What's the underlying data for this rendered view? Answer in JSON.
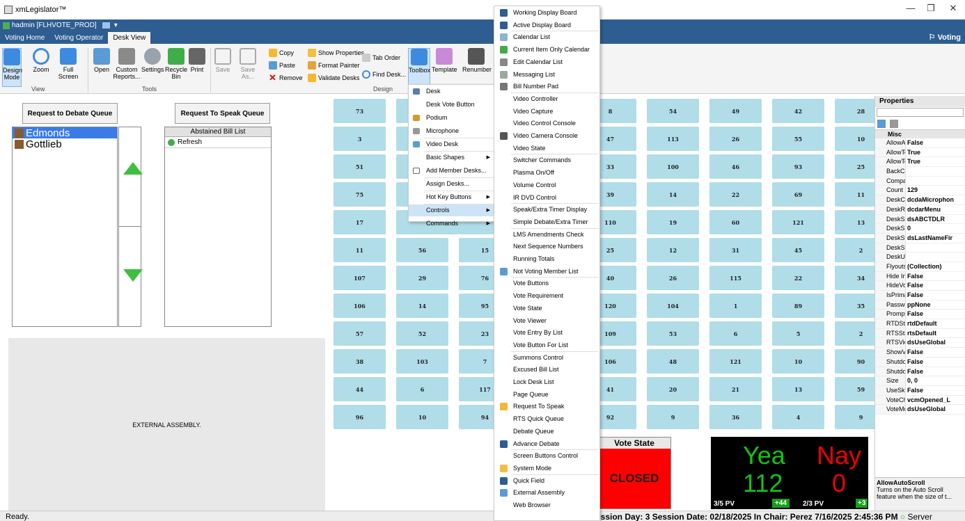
{
  "window": {
    "title": "xmLegislator™",
    "min": "—",
    "max": "❐",
    "close": "✕"
  },
  "user": {
    "label": "hadmin [FLHVOTE_PROD]"
  },
  "ribbon_tabs": [
    "Voting Home",
    "Voting Operator",
    "Desk View"
  ],
  "right_title": "Voting",
  "ribbon": {
    "design_mode": "Design Mode",
    "zoom": "Zoom",
    "full_screen": "Full Screen",
    "open": "Open",
    "custom_reports": "Custom Reports...",
    "settings": "Settings",
    "recycle_bin": "Recycle Bin",
    "print": "Print",
    "save": "Save",
    "save_as": "Save As...",
    "copy": "Copy",
    "paste": "Paste",
    "remove": "Remove",
    "show_properties": "Show Properties",
    "format_painter": "Format Painter",
    "validate_desks": "Validate Desks",
    "tab_order": "Tab Order",
    "find_desk": "Find Desk...",
    "toolbox": "Toolbox",
    "template": "Template",
    "renumber": "Renumber",
    "group_view": "View",
    "group_tools": "Tools",
    "group_design": "Design"
  },
  "queues": {
    "debate": "Request to Debate Queue",
    "speak": "Request To Speak Queue"
  },
  "members": [
    "Edmonds",
    "Gottlieb"
  ],
  "abstained": {
    "header": "Abstained Bill List",
    "refresh": "Refresh"
  },
  "external_assembly": "EXTERNAL ASSEMBLY.",
  "desks": [
    [
      "73",
      "",
      "",
      "8",
      "54",
      "49",
      "42",
      "28"
    ],
    [
      "3",
      "",
      "",
      "47",
      "113",
      "26",
      "55",
      "10"
    ],
    [
      "51",
      "",
      "",
      "33",
      "100",
      "46",
      "93",
      "25"
    ],
    [
      "75",
      "",
      "",
      "39",
      "14",
      "22",
      "69",
      "11"
    ],
    [
      "17",
      "",
      "",
      "110",
      "19",
      "60",
      "121",
      "13"
    ],
    [
      "11",
      "56",
      "15",
      "25",
      "12",
      "31",
      "45",
      "2"
    ],
    [
      "107",
      "29",
      "76",
      "40",
      "26",
      "115",
      "22",
      "34"
    ],
    [
      "106",
      "14",
      "95",
      "120",
      "104",
      "1",
      "89",
      "35"
    ],
    [
      "57",
      "52",
      "23",
      "109",
      "53",
      "6",
      "5",
      "2"
    ],
    [
      "38",
      "103",
      "7",
      "106",
      "48",
      "121",
      "10",
      "90"
    ],
    [
      "44",
      "6",
      "117",
      "41",
      "20",
      "21",
      "13",
      "59"
    ],
    [
      "96",
      "10",
      "94",
      "92",
      "9",
      "36",
      "4",
      "9"
    ]
  ],
  "vote_state": {
    "title": "Vote State",
    "value": "CLOSED"
  },
  "tally": {
    "yea_label": "Yea",
    "nay_label": "Nay",
    "yea": "112",
    "nay": "0",
    "pv1": "3/5 PV",
    "badge1": "+44",
    "pv2": "2/3 PV",
    "badge2": "+3"
  },
  "properties": {
    "title": "Properties",
    "category": "Misc",
    "rows": [
      [
        "AllowAuto",
        "False"
      ],
      [
        "AllowToo",
        "True"
      ],
      [
        "AllowToo",
        "True"
      ],
      [
        "BackColo",
        ""
      ],
      [
        "Compare",
        ""
      ],
      [
        "Count",
        "129"
      ],
      [
        "DeskClick",
        "dcdaMicrophon"
      ],
      [
        "DeskRigh",
        "dcdarMenu"
      ],
      [
        "DeskSort",
        "dsABCTDLR"
      ],
      [
        "DeskSort",
        "0"
      ],
      [
        "DeskStyle",
        "dsLastNameFir"
      ],
      [
        "DeskStyle",
        ""
      ],
      [
        "DeskUpd",
        ""
      ],
      [
        "Flyouts",
        "(Collection)"
      ],
      [
        "Hide InCh",
        "False"
      ],
      [
        "HideVote",
        "False"
      ],
      [
        "IsPrimary",
        "False"
      ],
      [
        "Passwor",
        "ppNone"
      ],
      [
        "PromptTo",
        "False"
      ],
      [
        "RTDState",
        "rtdDefault"
      ],
      [
        "RTSState",
        "rtsDefault"
      ],
      [
        "RTSView",
        "dsUseGlobal"
      ],
      [
        "ShowVVC",
        "False"
      ],
      [
        "Shutdown",
        "False"
      ],
      [
        "Shutdown",
        "False"
      ],
      [
        "Size",
        "0, 0"
      ],
      [
        "UseSkin",
        "False"
      ],
      [
        "VoteChar",
        "vcmOpened_L"
      ],
      [
        "VoteMoni",
        "dsUseGlobal"
      ]
    ],
    "desc_title": "AllowAutoScroll",
    "desc_text": "Turns on the Auto Scroll feature when the size of t..."
  },
  "status": {
    "left": "Ready.",
    "right": "ession Day: 3  Session Date: 02/18/2025  In Chair: Perez  7/16/2025 2:45:36 PM",
    "server": "Server"
  },
  "toolbox_menu": [
    "Desk",
    "Desk Vote Button",
    "Podium",
    "Microphone",
    "Video Desk",
    "Basic Shapes",
    "Add Member Desks...",
    "Assign Desks...",
    "Hot Key Buttons",
    "Controls",
    "Commands"
  ],
  "controls_menu": [
    "Working Display Board",
    "Active Display Board",
    "Calendar List",
    "Current Item Only Calendar",
    "Edit Calendar List",
    "Messaging List",
    "Bill Number Pad",
    "Video Controller",
    "Video Capture",
    "Video Control Console",
    "Video Camera Console",
    "Video State",
    "Switcher Commands",
    "Plasma On/Off",
    "Volume Control",
    "IR DVD Control",
    "Speak/Extra Timer Display",
    "Simple Debate/Extra Timer",
    "LMS Amendments Check",
    "Next Sequence Numbers",
    "Running Totals",
    "Not Voting Member List",
    "Vote Buttons",
    "Vote Requirement",
    "Vote State",
    "Vote Viewer",
    "Vote Entry By List",
    "Vote Button For List",
    "Summons Control",
    "Excused Bill List",
    "Lock Desk List",
    "Page Queue",
    "Request To Speak",
    "RTS Quick Queue",
    "Debate Queue",
    "Advance Debate",
    "Screen Buttons Control",
    "System Mode",
    "Quick Field",
    "External Assembly",
    "Web Browser"
  ],
  "colors": {
    "ribbon_blue": "#2d5d91",
    "desk": "#b0dde8",
    "closed": "#ff0000",
    "yea": "#15c215",
    "nay": "#ee0000"
  }
}
